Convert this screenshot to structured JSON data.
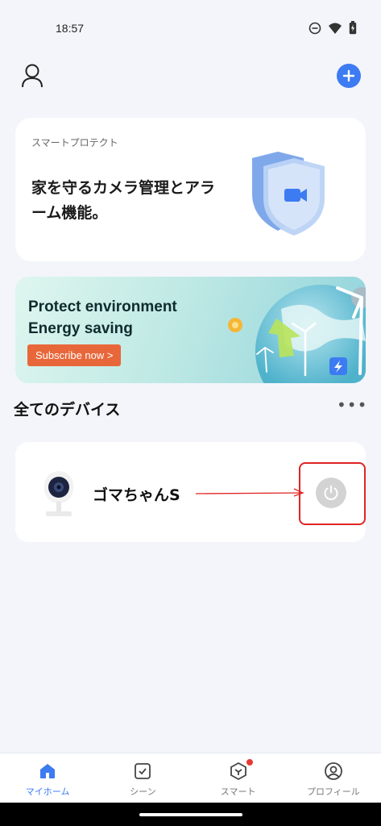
{
  "status": {
    "time": "18:57"
  },
  "protect": {
    "kicker": "スマートプロテクト",
    "title": "家を守るカメラ管理とアラーム機能。"
  },
  "banner": {
    "line1": "Protect environment",
    "line2": "Energy saving",
    "cta": "Subscribe now >"
  },
  "devices": {
    "section_title": "全てのデバイス",
    "more": "•••",
    "items": [
      {
        "name": "ゴマちゃんS",
        "power": "off"
      }
    ]
  },
  "tabs": [
    {
      "label": "マイホーム",
      "icon": "home-icon",
      "active": true
    },
    {
      "label": "シーン",
      "icon": "scene-check-icon",
      "active": false
    },
    {
      "label": "スマート",
      "icon": "smart-cube-icon",
      "active": false,
      "badge": true
    },
    {
      "label": "プロフィール",
      "icon": "profile-icon",
      "active": false
    }
  ],
  "colors": {
    "accent": "#3d7bf2",
    "annotation": "#e02424",
    "cta": "#e8673a"
  }
}
